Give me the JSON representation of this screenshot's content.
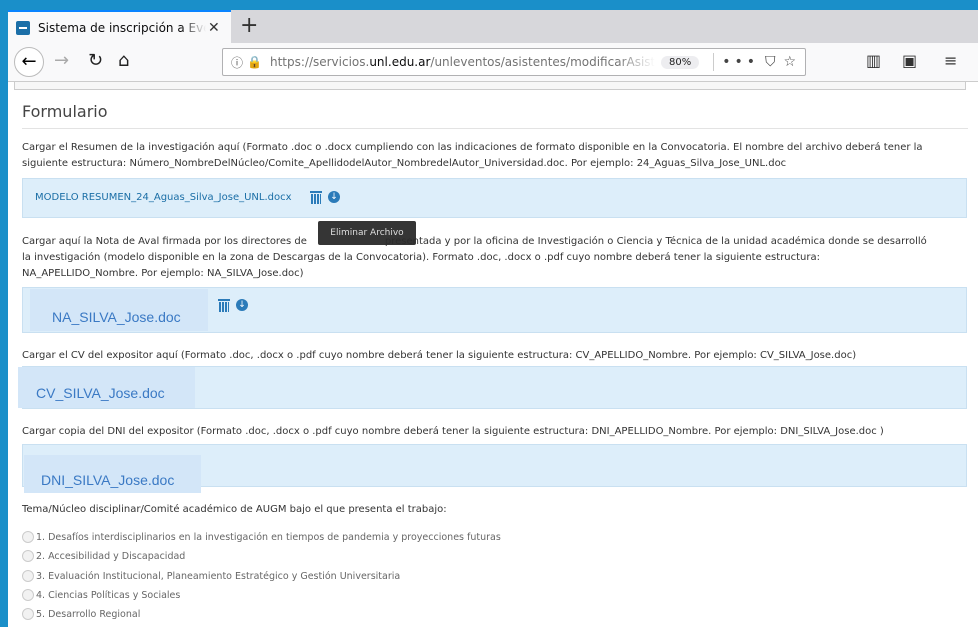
{
  "browser": {
    "tab_title": "Sistema de inscripción a Eventos",
    "new_tab": "+",
    "tab_close": "✕",
    "url_prefix": "https://servicios.",
    "url_domain": "unl.edu.ar",
    "url_path": "/unleventos/asistentes/modificarAsistente",
    "zoom": "80%",
    "page_actions": "•••"
  },
  "form": {
    "heading": "Formulario",
    "resumen": {
      "instructions": "Cargar el Resumen de la investigación aquí (Formato .doc o .docx cumpliendo con las indicaciones de formato disponible en la Convocatoria. El nombre del archivo deberá tener la siguiente estructura: Número_NombreDelNúcleo/Comite_ApellidodelAutor_NombredelAutor_Universidad.doc. Por ejemplo: 24_Aguas_Silva_Jose_UNL.doc",
      "file_name": "MODELO RESUMEN_24_Aguas_Silva_Jose_UNL.docx"
    },
    "tooltip": "Eliminar Archivo",
    "aval": {
      "instructions": "Cargar aquí la Nota de Aval firmada por los directores de [tooltip] presentada y por la oficina de Investigación o Ciencia y Técnica de la unidad académica donde se desarrolló la investigación (modelo disponible en la zona de Descargas de la Convocatoria). Formato .doc, .docx o .pdf cuyo nombre deberá tener la siguiente estructura: NA_APELLIDO_Nombre. Por ejemplo: NA_SILVA_Jose.doc)",
      "instructions_a": "Cargar aquí la Nota de Aval firmada por los directores de",
      "instructions_b": "presentada y por la oficina de Investigación o Ciencia y Técnica de la unidad académica donde se desarrolló",
      "instructions_c": "la investigación (modelo disponible en la zona de Descargas de la Convocatoria). Formato .doc, .docx o .pdf cuyo nombre deberá tener la siguiente estructura:",
      "instructions_d": "NA_APELLIDO_Nombre. Por ejemplo: NA_SILVA_Jose.doc)",
      "file_name": "NA_SILVA_Jose.doc"
    },
    "cv": {
      "instructions": "Cargar el CV del expositor aquí (Formato .doc, .docx o .pdf cuyo nombre deberá tener la siguiente estructura: CV_APELLIDO_Nombre. Por ejemplo: CV_SILVA_Jose.doc)",
      "file_name": "CV_SILVA_Jose.doc"
    },
    "dni": {
      "instructions": "Cargar copia del DNI del expositor (Formato .doc, .docx o .pdf cuyo nombre deberá tener la siguiente estructura: DNI_APELLIDO_Nombre. Por ejemplo: DNI_SILVA_Jose.doc )",
      "file_name": "DNI_SILVA_Jose.doc"
    },
    "tema_label": "Tema/Núcleo disciplinar/Comité académico de AUGM bajo el que presenta el trabajo:",
    "options": [
      "1. Desafíos interdisciplinarios en la investigación en tiempos de pandemia y proyecciones futuras",
      "2. Accesibilidad y Discapacidad",
      "3. Evaluación Institucional, Planeamiento Estratégico y Gestión Universitaria",
      "4. Ciencias Políticas y Sociales",
      "5. Desarrollo Regional"
    ]
  }
}
